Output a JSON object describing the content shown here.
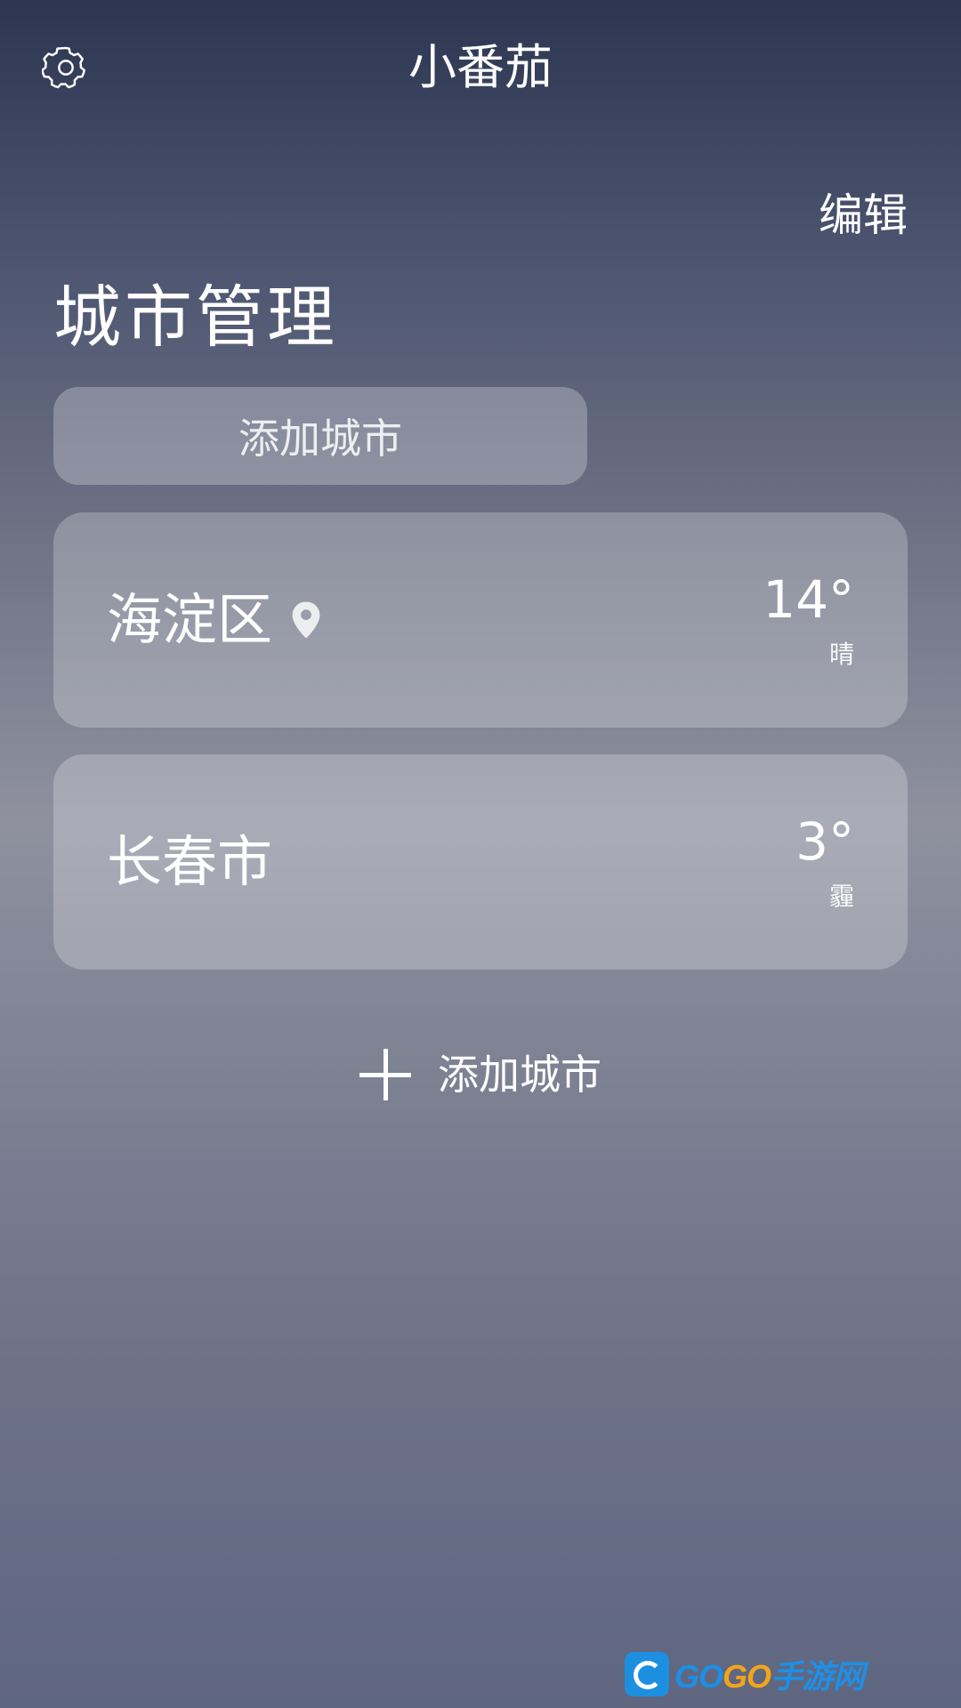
{
  "header": {
    "settings_icon": "gear-icon",
    "title": "小番茄",
    "edit_label": "编辑"
  },
  "page": {
    "title": "城市管理",
    "add_city_top_label": "添加城市"
  },
  "cities": [
    {
      "name": "海淀区",
      "is_current_location": true,
      "temperature": "14°",
      "condition": "晴"
    },
    {
      "name": "长春市",
      "is_current_location": false,
      "temperature": "3°",
      "condition": "霾"
    }
  ],
  "add_city_bottom": {
    "icon": "plus-icon",
    "label": "添加城市"
  },
  "watermark": {
    "part1": "GO",
    "part2": "GO",
    "part3": "手游网"
  },
  "colors": {
    "text": "#ffffff",
    "card_overlay": "rgba(255,255,255,0.24)",
    "background_top": "#2d3651",
    "background_bottom": "#5f6680"
  }
}
